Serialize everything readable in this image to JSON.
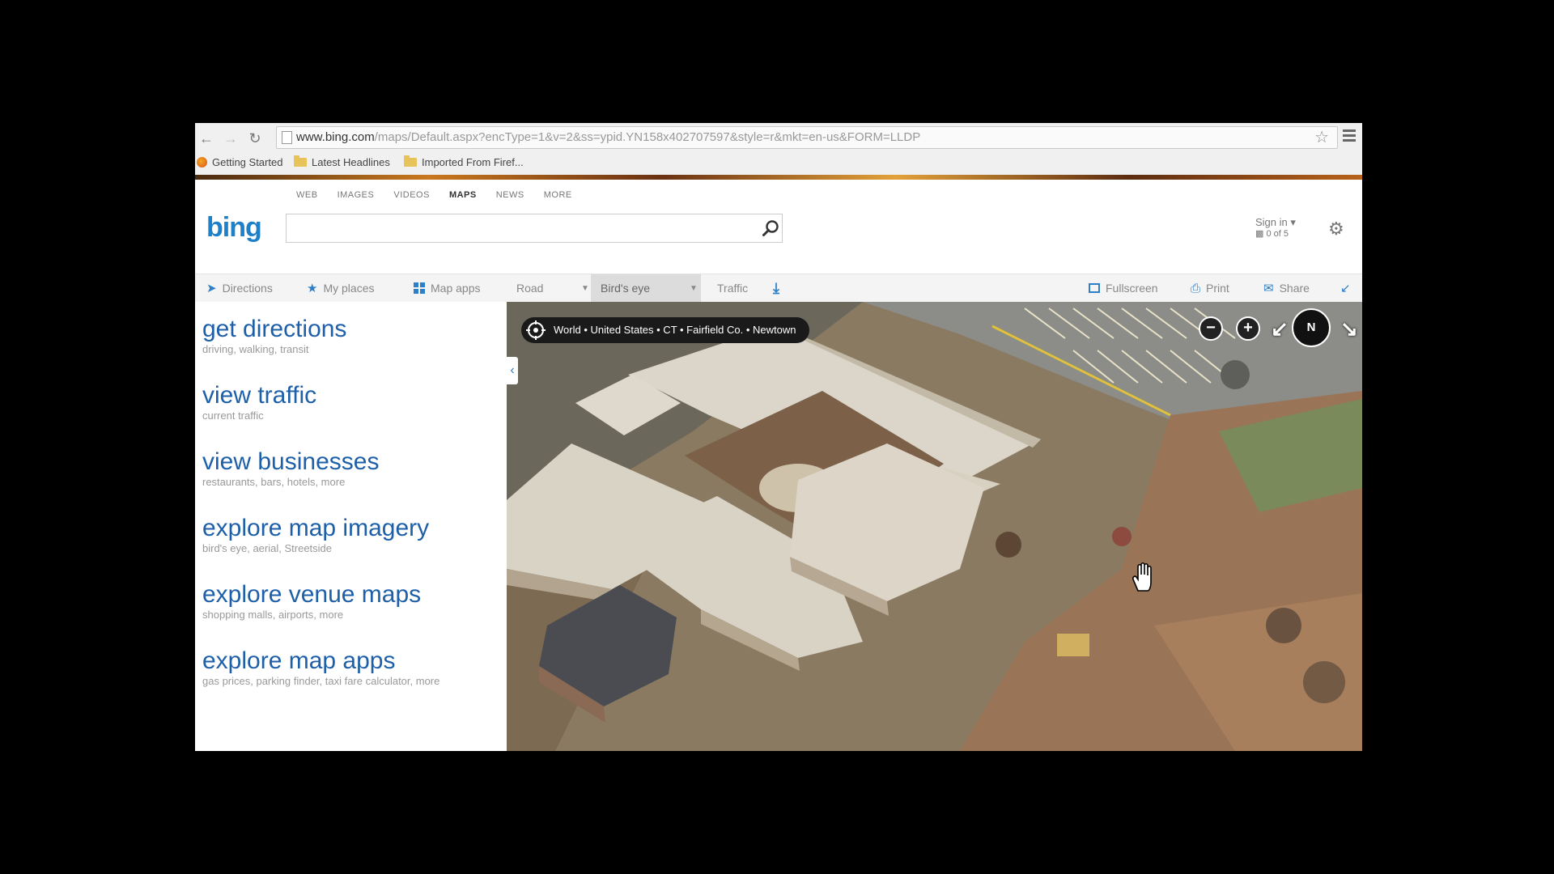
{
  "browser": {
    "url_host": "www.bing.com",
    "url_path": "/maps/Default.aspx?encType=1&v=2&ss=ypid.YN158x402707597&style=r&mkt=en-us&FORM=LLDP",
    "bookmarks": [
      "Getting Started",
      "Latest Headlines",
      "Imported From Firef..."
    ]
  },
  "header": {
    "logo": "bing",
    "nav": [
      "WEB",
      "IMAGES",
      "VIDEOS",
      "MAPS",
      "NEWS",
      "MORE"
    ],
    "sign_in": "Sign in ▾",
    "rewards": "0 of 5"
  },
  "toolbar": {
    "directions": "Directions",
    "my_places": "My places",
    "map_apps": "Map apps",
    "road": "Road",
    "birds_eye": "Bird's eye",
    "traffic": "Traffic",
    "fullscreen": "Fullscreen",
    "print": "Print",
    "share": "Share"
  },
  "tasks": [
    {
      "title": "get directions",
      "sub": "driving, walking, transit"
    },
    {
      "title": "view traffic",
      "sub": "current traffic"
    },
    {
      "title": "view businesses",
      "sub": "restaurants, bars, hotels, more"
    },
    {
      "title": "explore map imagery",
      "sub": "bird's eye, aerial, Streetside"
    },
    {
      "title": "explore venue maps",
      "sub": "shopping malls, airports, more"
    },
    {
      "title": "explore map apps",
      "sub": "gas prices, parking finder, taxi fare calculator, more"
    }
  ],
  "map": {
    "breadcrumb": "World • United States • CT • Fairfield Co. • Newtown",
    "compass_label": "N"
  },
  "colors": {
    "bing_blue": "#1c81c9",
    "link_blue": "#1d5fa8",
    "toolbar_icon": "#2d7fc7"
  }
}
